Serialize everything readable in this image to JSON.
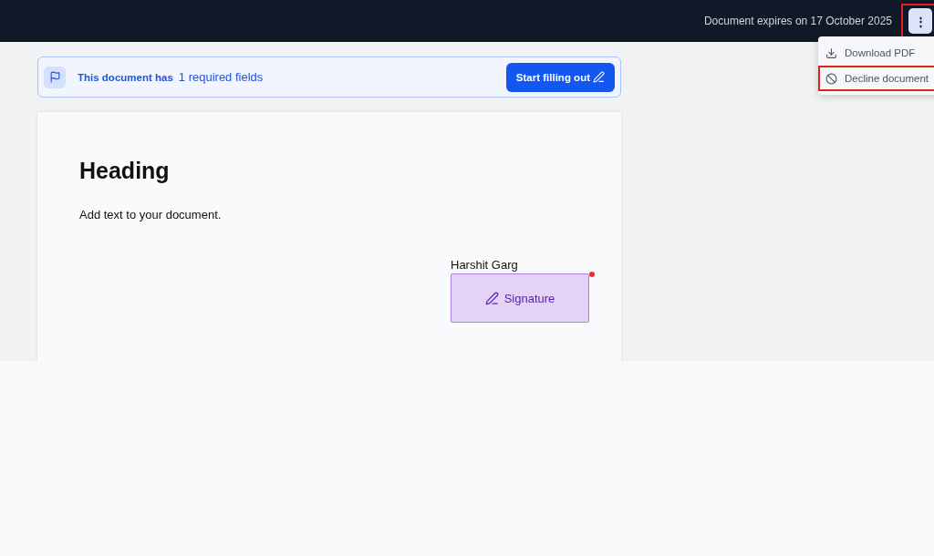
{
  "header": {
    "expiry": "Document expires on 17 October 2025",
    "menu_button": {
      "label": "⋮",
      "highlighted": true
    }
  },
  "menu": {
    "items": [
      {
        "kind": "download",
        "label": "Download PDF",
        "highlighted": false
      },
      {
        "kind": "decline",
        "label": "Decline document",
        "highlighted": true
      }
    ]
  },
  "banner": {
    "text": "This document has",
    "count": "1 required fields",
    "button": "Start filling out"
  },
  "document": {
    "heading": "Heading",
    "body": "Add text to your document.",
    "signer": "Harshit Garg",
    "field": {
      "label": "Signature",
      "required": true
    }
  }
}
